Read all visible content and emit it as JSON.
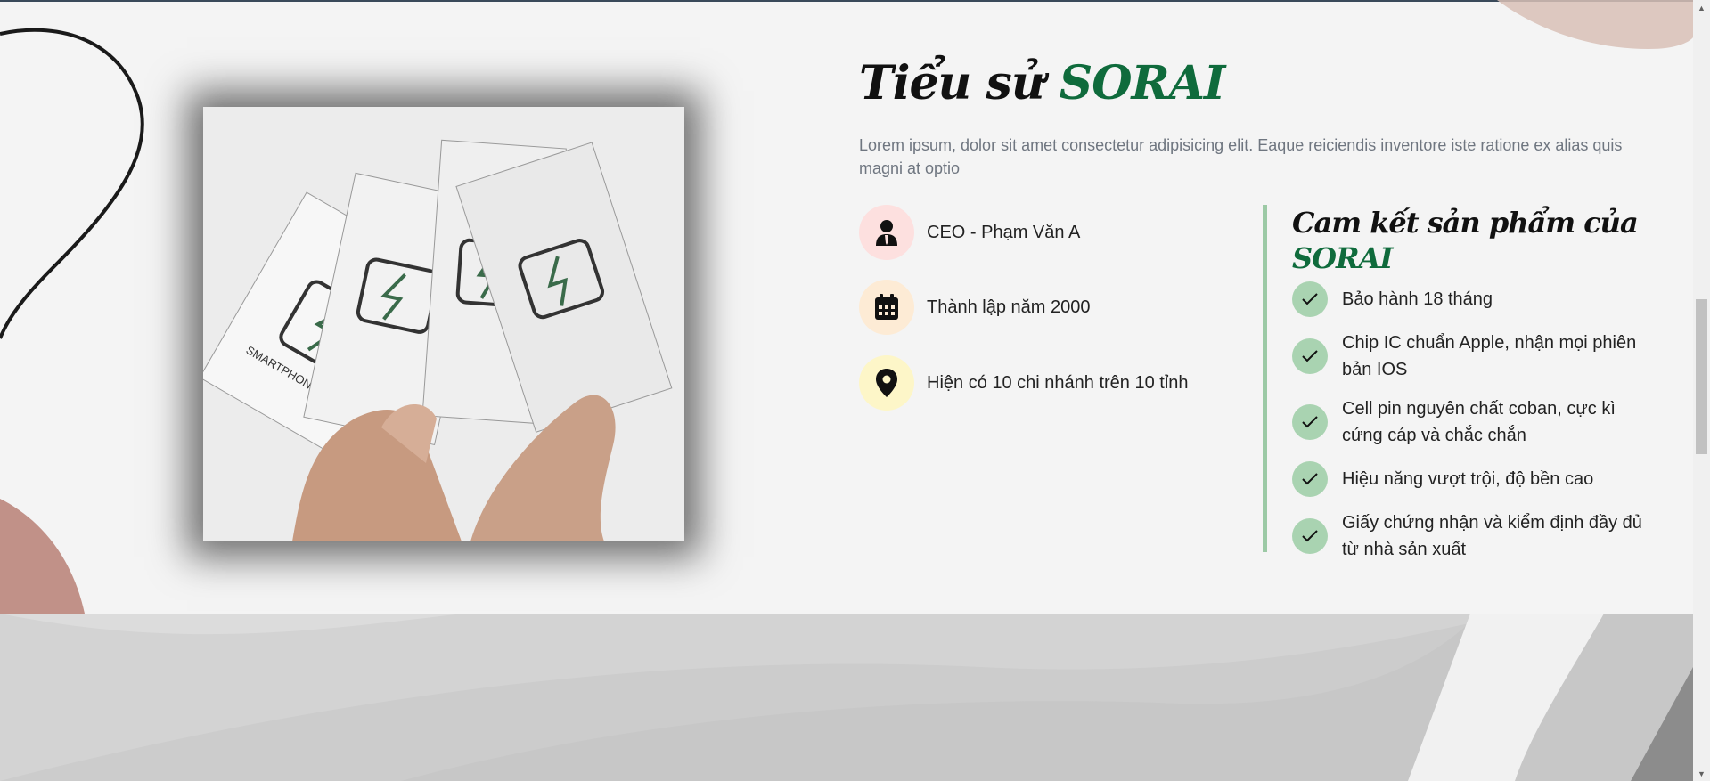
{
  "about": {
    "title_prefix": "Tiểu sử",
    "title_brand": "SORAI",
    "description": "Lorem ipsum, dolor sit amet consectetur adipisicing elit. Eaque reiciendis inventore iste ratione ex alias quis magni at optio"
  },
  "info": [
    {
      "icon": "user-tie-icon",
      "text": "CEO - Phạm Văn A",
      "bg": "#fde0df"
    },
    {
      "icon": "calendar-icon",
      "text": "Thành lập năm 2000",
      "bg": "#fdebd5"
    },
    {
      "icon": "map-pin-icon",
      "text": "Hiện có 10 chi nhánh trên 10 tỉnh",
      "bg": "#fdf6c8"
    }
  ],
  "commitment": {
    "title": "Cam kết sản phẩm của",
    "brand": "SORAI",
    "items": [
      "Bảo hành 18 tháng",
      "Chip IC chuẩn Apple, nhận mọi phiên bản IOS",
      "Cell pin nguyên chất coban, cực kì cứng cáp và chắc chắn",
      "Hiệu năng vượt trội, độ bền cao",
      "Giấy chứng nhận và kiểm định đầy đủ từ nhà sản xuất"
    ]
  },
  "photo": {
    "label": "SMARTPHONE BATTERY"
  },
  "colors": {
    "brand_green": "#0f6b3c",
    "check_green": "#a9d3b1",
    "divider": "#9cc9a5",
    "background": "#f4f4f4"
  }
}
